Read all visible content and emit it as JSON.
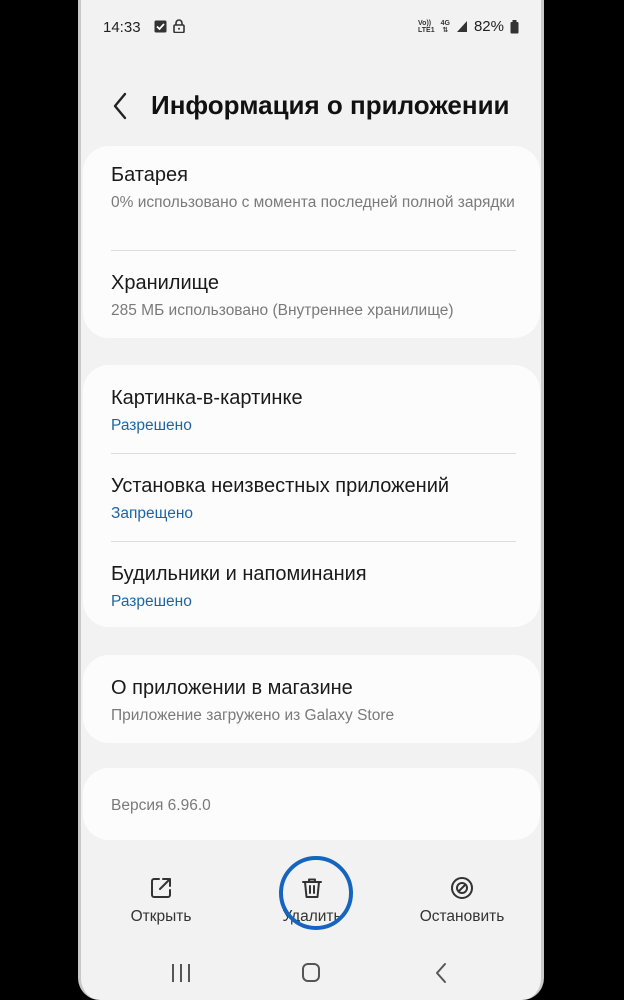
{
  "status_bar": {
    "time": "14:33",
    "volte": "Vo))",
    "lte": "LTE1",
    "network": "4G",
    "battery": "82%"
  },
  "header": {
    "title": "Информация о приложении"
  },
  "card1": {
    "battery_title": "Батарея",
    "battery_sub": "0% использовано с момента последней полной зарядки",
    "storage_title": "Хранилище",
    "storage_sub": "285 МБ использовано (Внутреннее хранилище)"
  },
  "card2": {
    "pip_title": "Картинка-в-картинке",
    "pip_status": "Разрешено",
    "unknown_title": "Установка неизвестных приложений",
    "unknown_status": "Запрещено",
    "alarms_title": "Будильники и напоминания",
    "alarms_status": "Разрешено"
  },
  "card3": {
    "store_title": "О приложении в магазине",
    "store_sub": "Приложение загружено из Galaxy Store"
  },
  "card4": {
    "version": "Версия 6.96.0"
  },
  "actions": {
    "open": "Открыть",
    "uninstall": "Удалить",
    "stop": "Остановить"
  },
  "colors": {
    "accent_blue": "#1a66a8",
    "highlight_ring": "#1565c0"
  }
}
